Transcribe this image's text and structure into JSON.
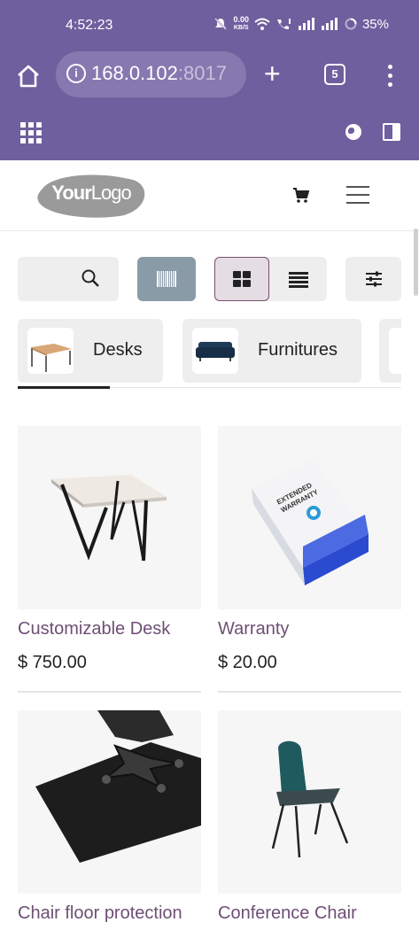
{
  "status_bar": {
    "time": "4:52:23",
    "net_speed": "0.00",
    "net_unit": "KB/S",
    "battery": "35%"
  },
  "browser": {
    "url_host": "168.0.102",
    "url_port": ":8017",
    "tab_count": "5"
  },
  "site": {
    "logo_text_bold": "Your",
    "logo_text_light": "Logo"
  },
  "categories": [
    {
      "label": "Desks",
      "icon": "desk-thumbnail"
    },
    {
      "label": "Furnitures",
      "icon": "sofa-thumbnail"
    }
  ],
  "products": [
    {
      "name": "Customizable Desk",
      "price": "$ 750.00"
    },
    {
      "name": "Warranty",
      "price": "$ 20.00"
    },
    {
      "name": "Chair floor protection",
      "price": ""
    },
    {
      "name": "Conference Chair",
      "price": ""
    }
  ],
  "warranty_box_text": [
    "EXTENDED",
    "WARRANTY"
  ],
  "colors": {
    "brand": "#6f5f9e",
    "product_link": "#6e4f74",
    "barcode_button": "#8a9ba8",
    "active_view_border": "#7a4f6e"
  }
}
